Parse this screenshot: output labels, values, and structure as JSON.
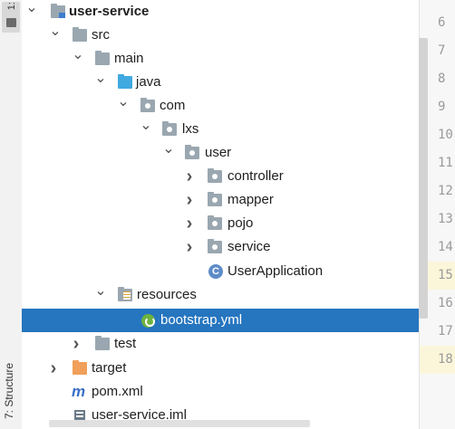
{
  "side": {
    "top_tab_label": "1:",
    "structure_tab_label": "7: Structure"
  },
  "tree": {
    "root": "user-service",
    "src": "src",
    "main": "main",
    "java": "java",
    "com": "com",
    "lxs": "lxs",
    "user": "user",
    "controller": "controller",
    "mapper": "mapper",
    "pojo": "pojo",
    "service": "service",
    "app": "UserApplication",
    "resources": "resources",
    "bootstrap": "bootstrap.yml",
    "test": "test",
    "target": "target",
    "pom": "pom.xml",
    "iml": "user-service.iml"
  },
  "maven_letter": "m",
  "gutter": {
    "lines": [
      "6",
      "7",
      "8",
      "9",
      "10",
      "11",
      "12",
      "13",
      "14",
      "15",
      "16",
      "17",
      "18"
    ],
    "highlighted_lines": [
      "15",
      "18"
    ]
  },
  "colors": {
    "selection": "#2675bf",
    "folder": "#9aa7b0",
    "source_folder": "#40a9e0",
    "excluded_folder": "#f0a05a",
    "spring": "#6db33f"
  }
}
